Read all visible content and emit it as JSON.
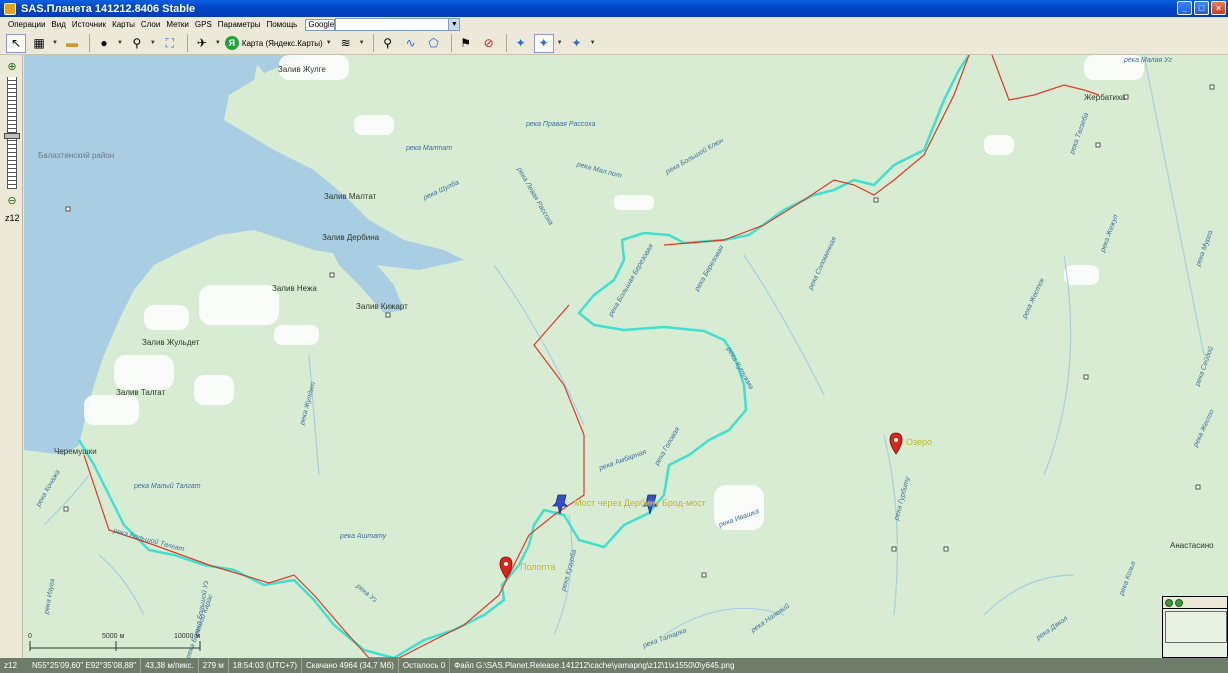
{
  "window": {
    "title": "SAS.Планета 141212.8406 Stable",
    "buttons": {
      "minimize": "_",
      "maximize": "□",
      "close": "×"
    }
  },
  "menu": {
    "items": [
      "Операции",
      "Вид",
      "Источник",
      "Карты",
      "Слои",
      "Метки",
      "GPS",
      "Параметры",
      "Помощь"
    ],
    "source": "Google"
  },
  "toolbar": {
    "map_label": "Карта (Яндекс.Карты)"
  },
  "zoom": {
    "level": "z12"
  },
  "map": {
    "water_labels": [
      {
        "text": "Залив Жулге"
      },
      {
        "text": "Залив Малтат"
      },
      {
        "text": "Залив Дербина"
      },
      {
        "text": "Залив Нежа"
      },
      {
        "text": "Залив Кижарт"
      },
      {
        "text": "Залив Жульдет"
      },
      {
        "text": "Залив Талгат"
      }
    ],
    "district_label": "Балахтинский район",
    "settlements": {
      "north": "Жербатиха",
      "east": "Анастасино",
      "west": "Черемушки"
    },
    "rivers": [
      "река Правая Рассоха",
      "река Малтат",
      "река Левая Рассоха",
      "река Шулба",
      "река Мал.пот",
      "река Большой Клюн",
      "река Березовая",
      "река Большая Березовая",
      "река Соломенная",
      "река Кутужма",
      "река Амбарная",
      "река Головая",
      "река Ивашка",
      "река Кузурба",
      "река Аштату",
      "река Малый Талгат",
      "река Большой Талгат",
      "река Кочажа",
      "река Жулдет",
      "река Тагзеба",
      "река Жежул",
      "река Мурга",
      "река Жесток",
      "река Гурбиту",
      "река Сейдой",
      "река Налевий",
      "река Татарка",
      "река Дякол",
      "река Жесто",
      "река Козьа",
      "река Изуга",
      "река Большой Уз",
      "река Уз",
      "река Большой Карас",
      "река Малая Уг"
    ],
    "markers": [
      {
        "label": "Полопта",
        "type": "red-pin"
      },
      {
        "label": "Мост через Дербину",
        "type": "blue-pushpin"
      },
      {
        "label": "Брод-мост",
        "type": "blue-pushpin"
      },
      {
        "label": "Озеро",
        "type": "red-pin"
      }
    ],
    "scale": {
      "ticks": [
        "0",
        "5000 м",
        "10000 м"
      ]
    },
    "colors": {
      "track": "#40e0d0",
      "route": "#e03a2a",
      "water": "#a9cde2",
      "land": "#d7ecd3",
      "marker_label": "#b6b11a"
    }
  },
  "status": {
    "level": "z12",
    "coords": "N55°25'09,60\" E92°35'08,88\"",
    "resolution": "43,38 м/пикс.",
    "altitude": "279 м",
    "time": "18:54:03 (UTC+7)",
    "downloaded": "Скачано 4964 (34,7 Мб)",
    "remaining": "Осталось 0",
    "file": "Файл G:\\SAS.Planet.Release.141212\\cache\\yamapng\\z12\\1\\x1550\\0\\y645.png"
  }
}
